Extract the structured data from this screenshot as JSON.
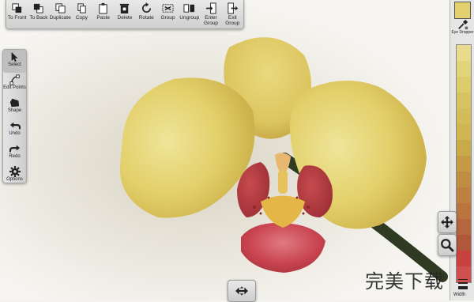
{
  "top_toolbar": {
    "to_front": "To Front",
    "to_back": "To Back",
    "duplicate": "Duplicate",
    "copy": "Copy",
    "paste": "Paste",
    "delete": "Delete",
    "rotate": "Rotate",
    "group": "Group",
    "ungroup": "Ungroup",
    "enter_group": "Enter Group",
    "exit_group": "Exit Group"
  },
  "left_toolbar": {
    "select": "Select",
    "edit_points": "Edit Points",
    "shape": "Shape",
    "undo": "Undo",
    "redo": "Redo",
    "options": "Options"
  },
  "right_panel": {
    "current_color": "#e2cf6e",
    "eye_dropper": "Eye Dropper",
    "width": "Width",
    "swatches": [
      "#e8dc8c",
      "#e1d47a",
      "#dccc6c",
      "#d6c463",
      "#d2bd5a",
      "#cfb653",
      "#c9aa4b",
      "#c49c45",
      "#c08e42",
      "#bd8241",
      "#b97440",
      "#b5663e",
      "#b0583b",
      "#c8433f",
      "#d0504f"
    ]
  },
  "float_buttons": {
    "move_icon": "move-arrows-icon",
    "zoom_icon": "magnifier-icon",
    "pan_icon": "horizontal-pan-icon"
  },
  "watermark": "完美下载"
}
